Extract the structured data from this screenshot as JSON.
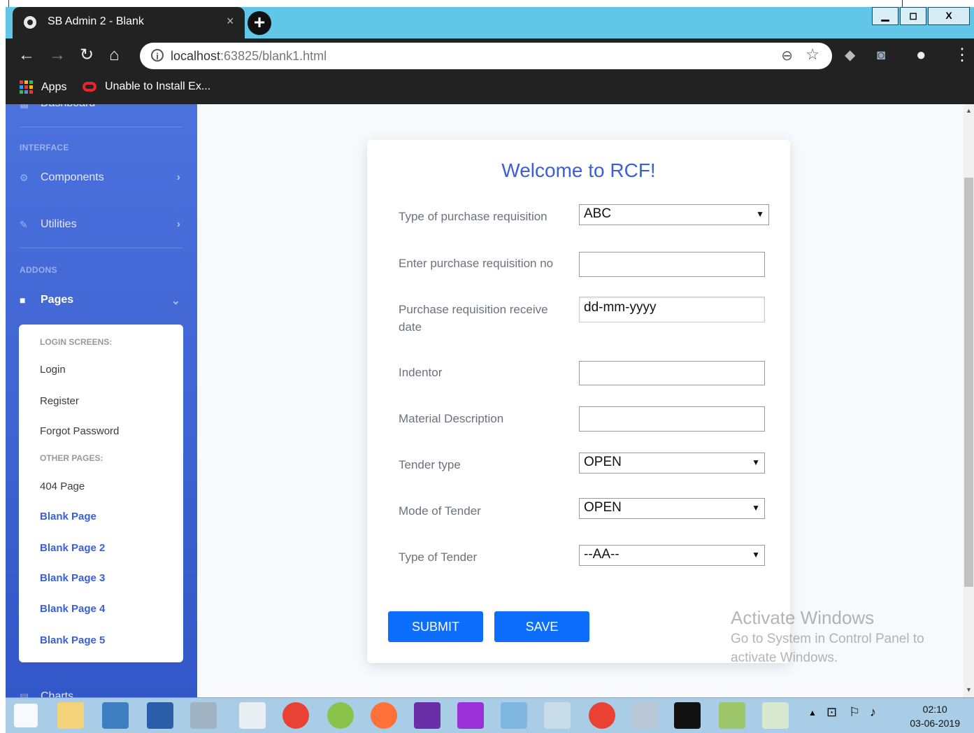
{
  "browser": {
    "tab_title": "SB Admin 2 - Blank",
    "tab_close": "×",
    "new_tab": "+",
    "window_buttons": {
      "minimize": "▁",
      "maximize": "◻",
      "close": "X"
    },
    "url_host": "localhost",
    "url_rest": ":63825/blank1.html",
    "bookmarks": [
      {
        "label": "Apps"
      },
      {
        "label": "Unable to Install Ex..."
      }
    ]
  },
  "sidebar": {
    "partial_top_label": "Dashboard",
    "heading_interface": "INTERFACE",
    "components_label": "Components",
    "utilities_label": "Utilities",
    "heading_addons": "ADDONS",
    "pages_label": "Pages",
    "pages_menu": {
      "login_heading": "LOGIN SCREENS:",
      "login": "Login",
      "register": "Register",
      "forgot": "Forgot Password",
      "other_heading": "OTHER PAGES:",
      "page404": "404 Page",
      "blank1": "Blank Page",
      "blank2": "Blank Page 2",
      "blank3": "Blank Page 3",
      "blank4": "Blank Page 4",
      "blank5": "Blank Page 5"
    },
    "partial_bottom_label": "Charts"
  },
  "form": {
    "title": "Welcome to RCF!",
    "type_of_pr_label": "Type of purchase requisition",
    "type_of_pr_value": "ABC",
    "pr_no_label": "Enter purchase requisition no",
    "pr_no_value": "",
    "pr_date_label": "Purchase requisition receive date",
    "pr_date_placeholder": "dd-mm-yyyy",
    "indentor_label": "Indentor",
    "indentor_value": "",
    "material_label": "Material Description",
    "material_value": "",
    "tender_type_label": "Tender type",
    "tender_type_value": "OPEN",
    "mode_label": "Mode of Tender",
    "mode_value": "OPEN",
    "type_tender_label": "Type of Tender",
    "type_tender_value": "--AA--",
    "submit_label": "SUBMIT",
    "save_label": "SAVE"
  },
  "watermark": {
    "line1": "Activate Windows",
    "line2": "Go to System in Control Panel to",
    "line3": "activate Windows."
  },
  "taskbar": {
    "time": "02:10",
    "date": "03-06-2019"
  },
  "colors": {
    "sidebar_top": "#4c72de",
    "primary_button": "#0d6efd",
    "title_blue": "#3a5fd8",
    "titlebar": "#62c6e8"
  }
}
